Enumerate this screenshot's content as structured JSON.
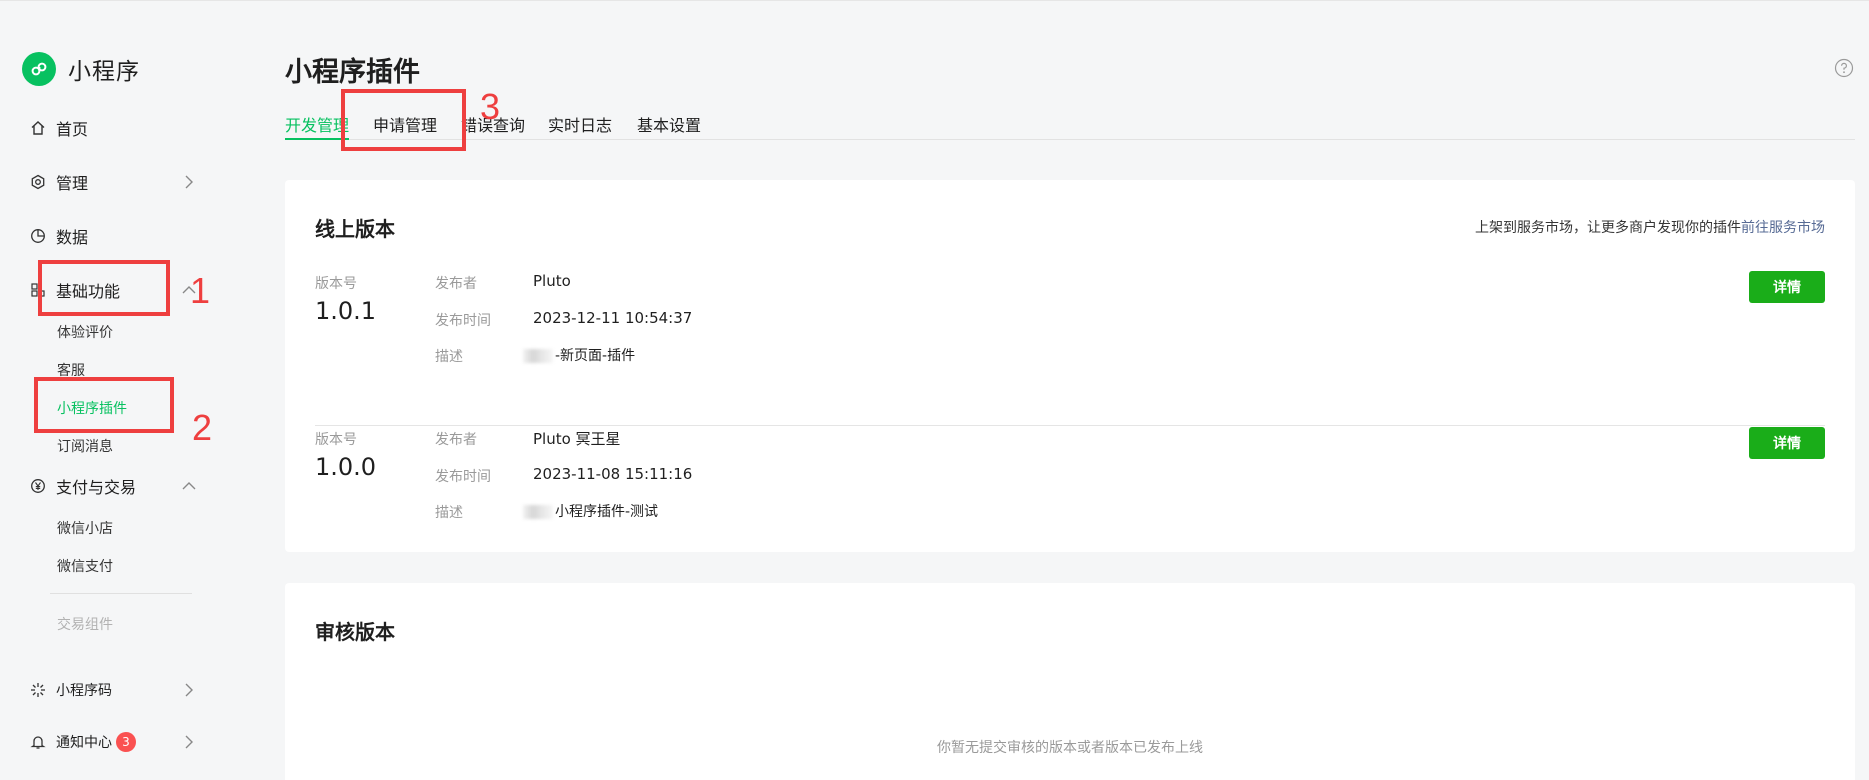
{
  "app": {
    "name": "小程序"
  },
  "sidebar": {
    "home": "首页",
    "manage": "管理",
    "data": "数据",
    "basic": {
      "label": "基础功能",
      "items": [
        "体验评价",
        "客服",
        "小程序插件",
        "订阅消息"
      ]
    },
    "pay": {
      "label": "支付与交易",
      "items": [
        "微信小店",
        "微信支付"
      ],
      "disabled_item": "交易组件"
    },
    "qrcode": "小程序码",
    "notify": {
      "label": "通知中心",
      "badge": "3"
    }
  },
  "annotations": [
    "1",
    "2",
    "3"
  ],
  "page": {
    "title": "小程序插件",
    "tabs": [
      "开发管理",
      "申请管理",
      "错误查询",
      "实时日志",
      "基本设置"
    ],
    "active_tab": "开发管理"
  },
  "online": {
    "title": "线上版本",
    "hint": "上架到服务市场，让更多商户发现你的插件",
    "hint_link": "前往服务市场",
    "labels": {
      "version": "版本号",
      "publisher": "发布者",
      "time": "发布时间",
      "desc": "描述"
    },
    "detail_label": "详情",
    "versions": [
      {
        "version": "1.0.1",
        "publisher": "Pluto",
        "time": "2023-12-11 10:54:37",
        "desc": "-新页面-插件"
      },
      {
        "version": "1.0.0",
        "publisher": "Pluto 冥王星",
        "time": "2023-11-08 15:11:16",
        "desc": "小程序插件-测试"
      }
    ]
  },
  "review": {
    "title": "审核版本",
    "empty": "你暂无提交审核的版本或者版本已发布上线"
  },
  "colors": {
    "brand": "#07c160",
    "button": "#1aad19",
    "annotation": "#ee3f3f",
    "link": "#576b95",
    "badge": "#fa5151"
  }
}
